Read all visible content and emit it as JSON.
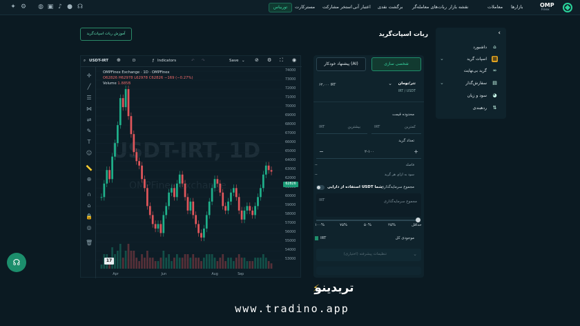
{
  "topbar": {
    "nav": [
      "بازارها",
      "معاملات",
      "نقشه بازار",
      "ربات‌های معامله‌گر",
      "برگشت نقدی",
      "اعتبار آنی",
      "استخر مشارکت",
      "مسترکارت"
    ],
    "active": "توربیاس",
    "brand": "OMP",
    "brand_sub": "Finex",
    "icons": [
      "twitter-icon",
      "settings-icon",
      "globe-icon",
      "wallet-icon",
      "bell-icon",
      "user-icon",
      "headset-icon"
    ]
  },
  "page": {
    "title": "ربات اسپات‌گرید",
    "tutorial_button": "آموزش ربات اسپات‌گرید"
  },
  "sidebar": {
    "items": [
      {
        "label": "داشبورد",
        "icon": "home-icon"
      },
      {
        "label": "اسپات گرید",
        "icon": "grid-icon"
      },
      {
        "label": "گرید بی‌نهایت",
        "icon": "infinity-icon"
      },
      {
        "label": "سفارش‌گذار",
        "icon": "order-icon"
      },
      {
        "label": "سود و زیان",
        "icon": "pie-icon"
      },
      {
        "label": "ردهبندی",
        "icon": "ranking-icon"
      }
    ]
  },
  "chart_toolbar": {
    "symbol": "USDT-IRT",
    "interval": "D",
    "indicators": "Indicators",
    "save": "Save"
  },
  "legend": {
    "title": "OMPFinex Exchange · 1D · OMPFinex",
    "ohlc": "O62826 H62978 L62978 C62826 −169 (−0.27%)",
    "volume_label": "Volume",
    "volume_value": "1.885B"
  },
  "watermark": {
    "main": "USDT-IRT, 1D",
    "sub": "OMPFinex Exchange"
  },
  "chart_data": {
    "type": "line",
    "x_labels": [
      "Apr",
      "Jun",
      "Aug",
      "Sep"
    ],
    "y_ticks": [
      74000,
      73000,
      72000,
      71000,
      70000,
      69000,
      68000,
      67000,
      66000,
      65000,
      64000,
      63000,
      62000,
      61000,
      60000,
      59000,
      58000,
      57000,
      56000,
      55000,
      54000,
      53000
    ],
    "ylim": [
      52500,
      74000
    ],
    "last_price": "62826",
    "values": [
      60000,
      61500,
      63000,
      62000,
      64500,
      66000,
      68000,
      71000,
      70000,
      72000,
      69000,
      67000,
      65000,
      64000,
      63500,
      62000,
      61000,
      59000,
      58000,
      57000,
      56500,
      57000,
      56000,
      58000,
      59000,
      60500,
      61000,
      60000,
      61500,
      62500,
      61500,
      60000,
      58500,
      59500,
      58000,
      57000,
      56000,
      55500,
      56500,
      58000,
      59500,
      61000,
      62000,
      61500,
      60500,
      59000,
      58500,
      59500,
      60500,
      61000,
      60000,
      58500,
      57500,
      58500,
      59000,
      58500,
      58000,
      59000,
      60000,
      61000,
      62500,
      63500,
      63000,
      62826
    ]
  },
  "form": {
    "tab_custom": "شخصی سازی",
    "tab_ai": "پیشنهاد خودکار (AI)",
    "pair_name": "تتر/تومان",
    "pair_sub": "IRT / USDT",
    "pair_price": "۶۳,۰۰۰ IRT",
    "price_range": "محدوده قیمت",
    "min_price": "کمترین",
    "max_price": "بیشترین",
    "unit": "IRT",
    "grid_count": "تعداد گرید",
    "grid_value": "۲-۱۰۰",
    "spacing": "فاصله",
    "profit_per_grid": "سود به ازای هر گرید",
    "investment_total": "مجموع سرمایه‌گذاری",
    "use_usdt": "استفاده از دارایی USDT شما",
    "investment_placeholder": "مجموع سرمایه‌گذاری",
    "pcts": [
      "حداقل",
      "۲۵%",
      "۵۰%",
      "۷۵%",
      "۱۰۰%"
    ],
    "balance_label": "موجودی کل",
    "balance_value": "IRT",
    "advanced": "تنظیمات پیشرفته (اختیاری)",
    "dash": "--"
  },
  "branding": {
    "name": "تریدینو",
    "url": "www.tradino.app"
  }
}
